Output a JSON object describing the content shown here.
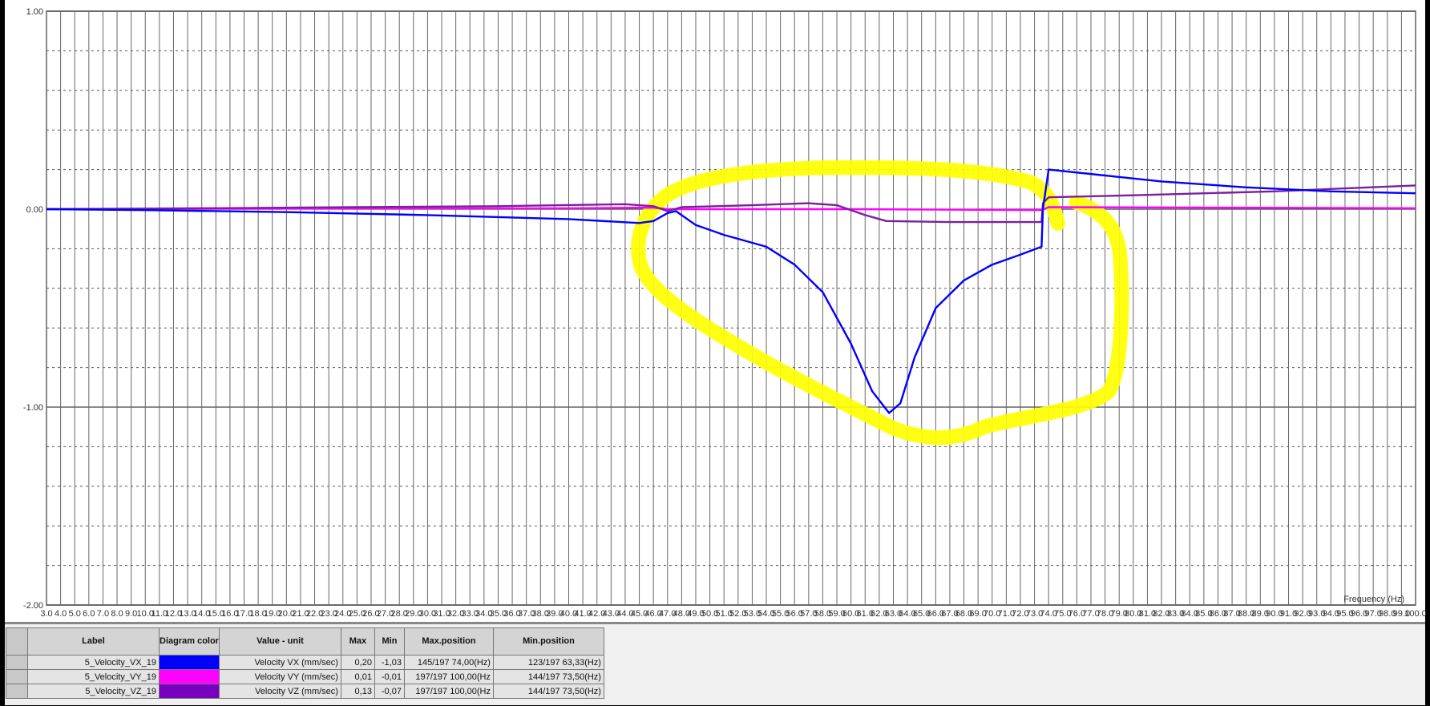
{
  "chart_data": {
    "type": "line",
    "title": "",
    "xlabel": "Frequency (Hz)",
    "ylabel": "",
    "xlim": [
      3,
      100
    ],
    "ylim": [
      -2,
      1
    ],
    "x_ticks": {
      "start": 3,
      "end": 100,
      "step": 1
    },
    "y_tick_labels": [
      "1.00",
      "0.00",
      "-1.00",
      "-2.00"
    ],
    "y_tick_values": [
      1,
      0,
      -1,
      -2
    ],
    "grid": true,
    "series": [
      {
        "name": "5_Velocity_VX_19",
        "color": "#0000ff",
        "points": [
          [
            3,
            0
          ],
          [
            10,
            -0.005
          ],
          [
            20,
            -0.015
          ],
          [
            30,
            -0.03
          ],
          [
            40,
            -0.05
          ],
          [
            45,
            -0.07
          ],
          [
            46,
            -0.06
          ],
          [
            47,
            -0.02
          ],
          [
            47.6,
            -0.01
          ],
          [
            49,
            -0.08
          ],
          [
            51,
            -0.13
          ],
          [
            54,
            -0.19
          ],
          [
            56,
            -0.28
          ],
          [
            58,
            -0.42
          ],
          [
            60,
            -0.68
          ],
          [
            61.5,
            -0.92
          ],
          [
            62.7,
            -1.03
          ],
          [
            63.5,
            -0.98
          ],
          [
            64.5,
            -0.75
          ],
          [
            66,
            -0.5
          ],
          [
            68,
            -0.36
          ],
          [
            70,
            -0.28
          ],
          [
            72,
            -0.23
          ],
          [
            73.5,
            -0.19
          ],
          [
            73.6,
            0.0
          ],
          [
            74,
            0.2
          ],
          [
            78,
            0.17
          ],
          [
            82,
            0.14
          ],
          [
            88,
            0.11
          ],
          [
            94,
            0.09
          ],
          [
            100,
            0.08
          ]
        ]
      },
      {
        "name": "5_Velocity_VY_19",
        "color": "#ff00ff",
        "points": [
          [
            3,
            0
          ],
          [
            20,
            0.003
          ],
          [
            40,
            0.005
          ],
          [
            46,
            0.008
          ],
          [
            47,
            0.0
          ],
          [
            60,
            0.0
          ],
          [
            73.5,
            -0.005
          ],
          [
            74,
            0.01
          ],
          [
            100,
            0.005
          ]
        ]
      },
      {
        "name": "5_Velocity_VZ_19",
        "color": "#7a1fa2",
        "points": [
          [
            3,
            0
          ],
          [
            15,
            0.005
          ],
          [
            25,
            0.01
          ],
          [
            35,
            0.015
          ],
          [
            44,
            0.025
          ],
          [
            46,
            0.015
          ],
          [
            47,
            -0.01
          ],
          [
            48,
            0.01
          ],
          [
            53,
            0.02
          ],
          [
            57,
            0.03
          ],
          [
            59,
            0.02
          ],
          [
            61,
            -0.03
          ],
          [
            62.5,
            -0.06
          ],
          [
            67,
            -0.065
          ],
          [
            73.5,
            -0.065
          ],
          [
            73.6,
            0.03
          ],
          [
            74,
            0.06
          ],
          [
            80,
            0.07
          ],
          [
            90,
            0.09
          ],
          [
            100,
            0.12
          ]
        ]
      }
    ]
  },
  "annotation_color": "#ffff00",
  "table": {
    "headers": [
      "Label",
      "Diagram color",
      "Value - unit",
      "Max",
      "Min",
      "Max.position",
      "Min.position"
    ],
    "rows": [
      {
        "label": "5_Velocity_VX_19",
        "color": "#0000ff",
        "value_unit": "Velocity VX (mm/sec)",
        "max": "0,20",
        "min": "-1,03",
        "max_position": "145/197 74,00(Hz)",
        "min_position": "123/197 63,33(Hz)"
      },
      {
        "label": "5_Velocity_VY_19",
        "color": "#ff00ff",
        "value_unit": "Velocity VY (mm/sec)",
        "max": "0,01",
        "min": "-0,01",
        "max_position": "197/197 100,00(Hz",
        "min_position": "144/197 73,50(Hz)"
      },
      {
        "label": "5_Velocity_VZ_19",
        "color": "#7a00c0",
        "value_unit": "Velocity VZ (mm/sec)",
        "max": "0,13",
        "min": "-0,07",
        "max_position": "197/197 100,00(Hz",
        "min_position": "144/197 73,50(Hz)"
      }
    ]
  }
}
